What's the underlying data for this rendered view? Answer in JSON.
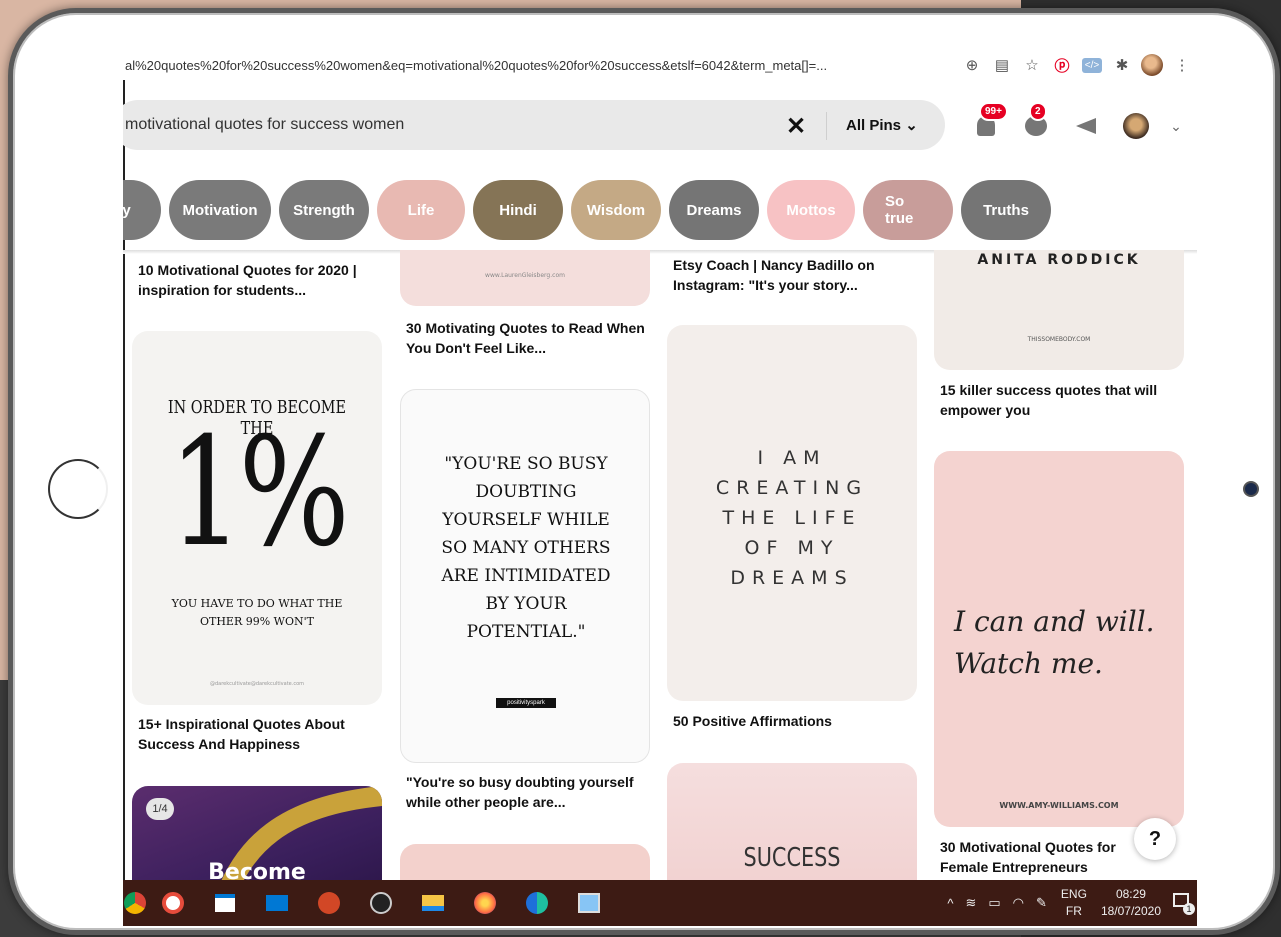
{
  "browser": {
    "url": "al%20quotes%20for%20success%20women&eq=motivational%20quotes%20for%20success&etslf=6042&term_meta[]=..."
  },
  "header": {
    "search_value": "motivational quotes for success women",
    "filter_label": "All Pins",
    "notifications_badge": "99+",
    "messages_badge": "2"
  },
  "pills": [
    {
      "label": "py",
      "color": "#7a7a7a"
    },
    {
      "label": "Motivation",
      "color": "#7a7a7a"
    },
    {
      "label": "Strength",
      "color": "#7a7a7a"
    },
    {
      "label": "Life",
      "color": "#e8b9b2"
    },
    {
      "label": "Hindi",
      "color": "#857456"
    },
    {
      "label": "Wisdom",
      "color": "#c4a985"
    },
    {
      "label": "Dreams",
      "color": "#757575"
    },
    {
      "label": "Mottos",
      "color": "#f7c2c4"
    },
    {
      "label": "So true",
      "color": "#c89d9a"
    },
    {
      "label": "Truths",
      "color": "#757575"
    }
  ],
  "pins": {
    "c1_title1": "10 Motivational Quotes for 2020 | inspiration for students...",
    "c1_q_top": "IN ORDER TO BECOME THE",
    "c1_q_big": "1%",
    "c1_q_bottom": "YOU HAVE TO DO WHAT THE OTHER 99% WON'T",
    "c1_q_credit": "@darekcultivate@darekcultivate.com",
    "c1_title2": "15+ Inspirational Quotes About Success And Happiness",
    "c1_counter": "1/4",
    "c1_become": "Become",
    "c2_site": "www.LaurenGleisberg.com",
    "c2_title1": "30 Motivating Quotes to Read When You Don't Feel Like...",
    "c2_quote": "\"YOU'RE SO BUSY DOUBTING YOURSELF WHILE SO MANY OTHERS ARE INTIMIDATED BY YOUR POTENTIAL.\"",
    "c2_credit": "positivityspark",
    "c2_title2": "\"You're so busy doubting yourself while other people are...",
    "c3_title1": "Etsy Coach | Nancy Badillo on Instagram: \"It's your story...",
    "c3_quote": "I AM CREATING THE LIFE OF MY DREAMS",
    "c3_title2": "50 Positive Affirmations",
    "c3_success": "SUCCESS",
    "c4_author": "ANITA RODDICK",
    "c4_site": "THISSOMEBODY.COM",
    "c4_title1": "15 killer success quotes that will empower you",
    "c4_quote": "I can and will. Watch me.",
    "c4_site2": "WWW.AMY-WILLIAMS.COM",
    "c4_title2": "30 Motivational Quotes for Female Entrepreneurs"
  },
  "help_label": "?",
  "taskbar": {
    "lang_top": "ENG",
    "lang_bottom": "FR",
    "time": "08:29",
    "date": "18/07/2020",
    "notif_count": "1"
  }
}
